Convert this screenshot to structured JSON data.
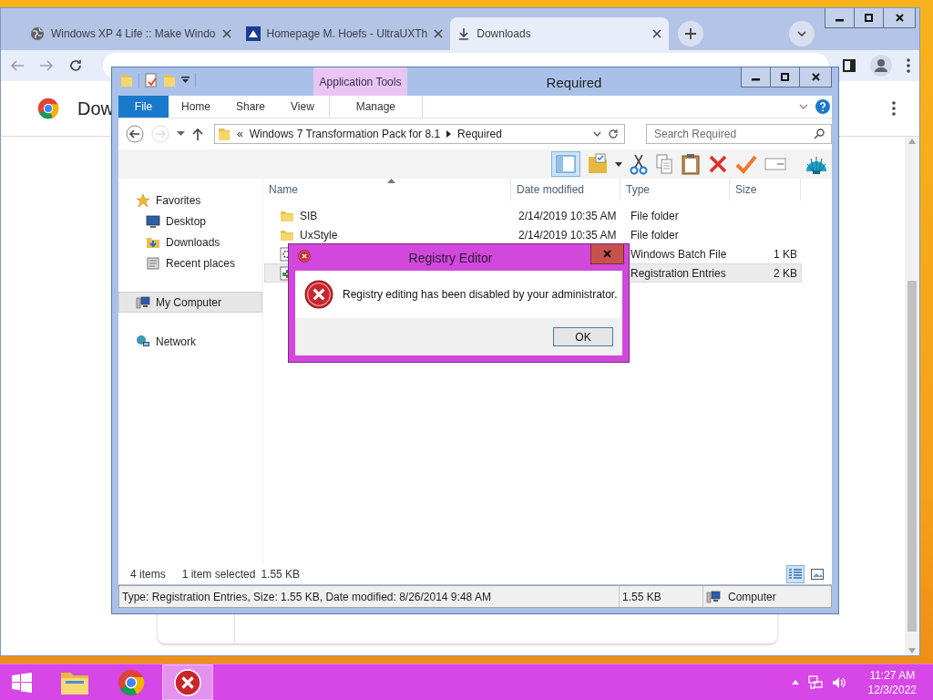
{
  "browser": {
    "tabs": [
      {
        "title": "Windows XP 4 Life :: Make Windo",
        "selected": false
      },
      {
        "title": "Homepage M. Hoefs - UltraUXTh",
        "selected": false
      },
      {
        "title": "Downloads",
        "selected": true
      }
    ],
    "page_title": "Dow"
  },
  "explorer": {
    "title": "Required",
    "contextual_tab": "Application Tools",
    "ribbon_tabs": [
      {
        "label": "File",
        "kind": "file"
      },
      {
        "label": "Home",
        "kind": "plain"
      },
      {
        "label": "Share",
        "kind": "plain"
      },
      {
        "label": "View",
        "kind": "plain"
      },
      {
        "label": "Manage",
        "kind": "contextual"
      }
    ],
    "breadcrumb_prefix": "«",
    "breadcrumb": [
      "Windows 7 Transformation Pack for 8.1",
      "Required"
    ],
    "search": {
      "placeholder": "Search Required"
    },
    "nav": [
      {
        "label": "Favorites",
        "selected": false,
        "children": [
          {
            "label": "Desktop",
            "selected": false
          },
          {
            "label": "Downloads",
            "selected": false
          },
          {
            "label": "Recent places",
            "selected": false
          }
        ]
      },
      {
        "label": "My Computer",
        "selected": true
      },
      {
        "label": "Network",
        "selected": false
      }
    ],
    "columns": [
      "Name",
      "Date modified",
      "Type",
      "Size"
    ],
    "rows": [
      {
        "kind": "folder",
        "name": "SIB",
        "date": "2/14/2019 10:35 AM",
        "type": "File folder",
        "selected": false
      },
      {
        "kind": "folder",
        "name": "UxStyle",
        "date": "2/14/2019 10:35 AM",
        "type": "File folder",
        "selected": false
      },
      {
        "kind": "batch",
        "type": "Windows Batch File",
        "size": "1 KB",
        "selected": false
      },
      {
        "kind": "registry",
        "type": "Registration Entries",
        "size": "2 KB",
        "selected": true
      }
    ],
    "item_count": "4 items",
    "selection_count": "1 item selected",
    "selection_size": "1.55 KB",
    "details": {
      "description": "Type: Registration Entries, Size: 1.55 KB, Date modified: 8/26/2014 9:48 AM",
      "size": "1.55 KB",
      "location": "Computer"
    }
  },
  "dialog": {
    "title": "Registry Editor",
    "message": "Registry editing has been disabled by your administrator.",
    "button": "OK"
  },
  "taskbar": {
    "apps": [
      {
        "selected": false
      },
      {
        "selected": false
      },
      {
        "selected": true
      }
    ],
    "time": "11:27 AM",
    "date": "12/3/2022"
  }
}
